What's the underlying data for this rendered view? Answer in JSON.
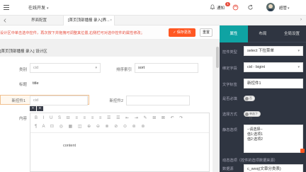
{
  "topbar": {
    "online_dev_label": "在线开发",
    "notice_label": "通知",
    "notice_count": "1",
    "username": "超管"
  },
  "tabs": {
    "items": [
      {
        "label": "界面配置"
      },
      {
        "label": "[首页顶部播报 录入]界..."
      }
    ],
    "close_glyph": "×",
    "collapse_glyph": "›"
  },
  "toolbar": {
    "notice_text": "设计区中单击选中控件，再次按下并拖拽可调整其位置,右侧栏可对选中控件的属性修改；",
    "save_label": "保存更改",
    "reset_label": "重置"
  },
  "design": {
    "title": "[首页顶部播报 录入] 设计区",
    "fields": {
      "category_label": "类别",
      "category_value": "cid",
      "sort_label": "排序索引",
      "sort_value": "sort",
      "title_label": "标题",
      "title_value": "title",
      "ctrl1_label": "新控件1",
      "ctrl1_value": "cid",
      "ctrl2_label": "新控件2",
      "ctrl2_value": "",
      "content_label": "内容",
      "content_value": "content"
    },
    "mini_tools": [
      "+",
      "≡"
    ],
    "editor_toolbar": {
      "row1": "B I U S ⊟ ≡ ≡ ≡ ≡ ☰ ☰ ⇤ ⇥ ✎ ⊞ ⊠ ↶ ↷",
      "row2": "¶ A ⊡ ◎ ▦ ◫ ⊕ ⊖ ⊗ ⊘ ⊙ ⊚ ⊛"
    }
  },
  "panel": {
    "tabs": [
      "属性",
      "布局",
      "全局设置"
    ],
    "active_tab": 0,
    "rows": {
      "control_type_label": "控件类型",
      "control_type_value": "select 下拉菜单",
      "bind_field_label": "绑定字段",
      "bind_field_value": "cid - bigint",
      "text_label_label": "文字标签",
      "text_label_value": "新控件1",
      "required_label": "是否必填",
      "required_toggle": "否",
      "readonly_label": "选择方式",
      "readonly_toggle": "单选下拉",
      "option_list_label": "静态选项",
      "option_lines": [
        "--请选择--",
        "值1:选项1",
        "值2:选项2"
      ],
      "dynamic_label": "动态选项（控件的选项数据来源）",
      "data_source_label": "数据源",
      "data_source_value": "c_wxxj(文章分类表)"
    }
  },
  "colors": {
    "accent": "#0fa3a3",
    "save_button": "#ff5722",
    "panel_bg": "#2f3541",
    "notice_text": "#e74c3c"
  }
}
